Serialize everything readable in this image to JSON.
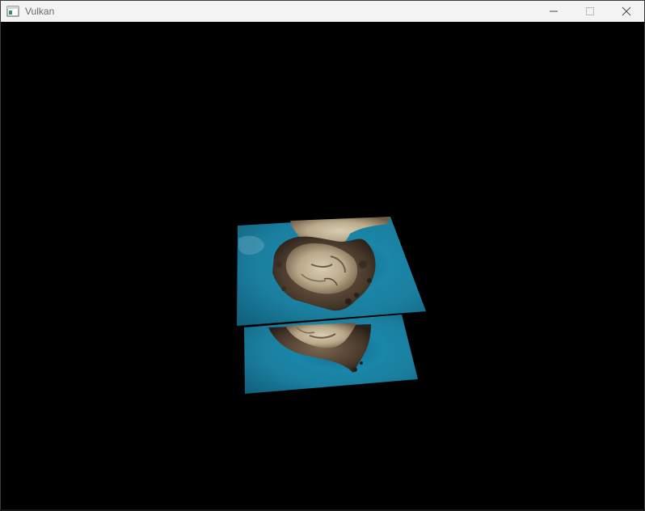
{
  "window": {
    "title": "Vulkan",
    "icon": "app-window-icon"
  },
  "caption_buttons": {
    "minimize_icon": "minimize-icon",
    "maximize_icon": "maximize-icon",
    "close_icon": "close-icon"
  },
  "scene": {
    "background": "#000000",
    "quad_color": "#1a7fa0",
    "quad_count": 2
  }
}
